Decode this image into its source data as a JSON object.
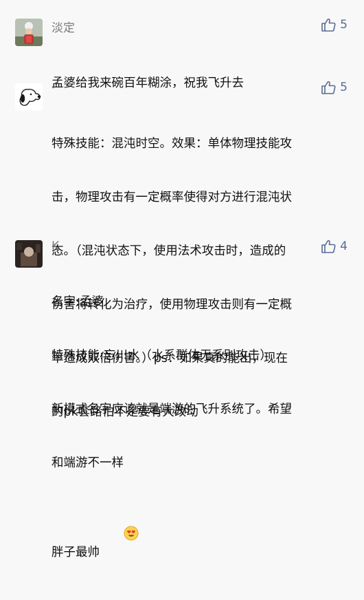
{
  "comments": [
    {
      "username": "淡定",
      "likes": "5",
      "text": [
        "孟婆给我来碗百年糊涂，祝我飞升去"
      ],
      "avatar_icon": "chef-photo-avatar"
    },
    {
      "username": "·",
      "likes": "5",
      "text": [
        "特殊技能：混沌时空。效果：单体物理技能攻",
        "击，物理攻击有一定概率使得对方进行混沌状",
        "态。（混沌状态下，使用法术攻击时，造成的",
        "伤害将转化为治疗，使用物理攻击则有一定概",
        "率造成双倍伤害。）ps：如果真的能出，现在",
        "的pk套路怕不是要有大改动"
      ],
      "avatar_icon": "snoopy-avatar"
    },
    {
      "username": "K",
      "likes": "4",
      "text": [
        "名字:孟婆",
        "特殊技能:忘川水（水系群体无系别攻击）",
        "新模式名字应该就是端游的飞升系统了。希望",
        "和端游不一样",
        "胖子最帅"
      ],
      "avatar_icon": "dark-photo-avatar",
      "emoji": "heart-eyes-emoji"
    }
  ],
  "colors": {
    "background": "#f8f8f8",
    "username": "#7a7a7a",
    "like_accent": "#576b95",
    "text": "#111111"
  }
}
